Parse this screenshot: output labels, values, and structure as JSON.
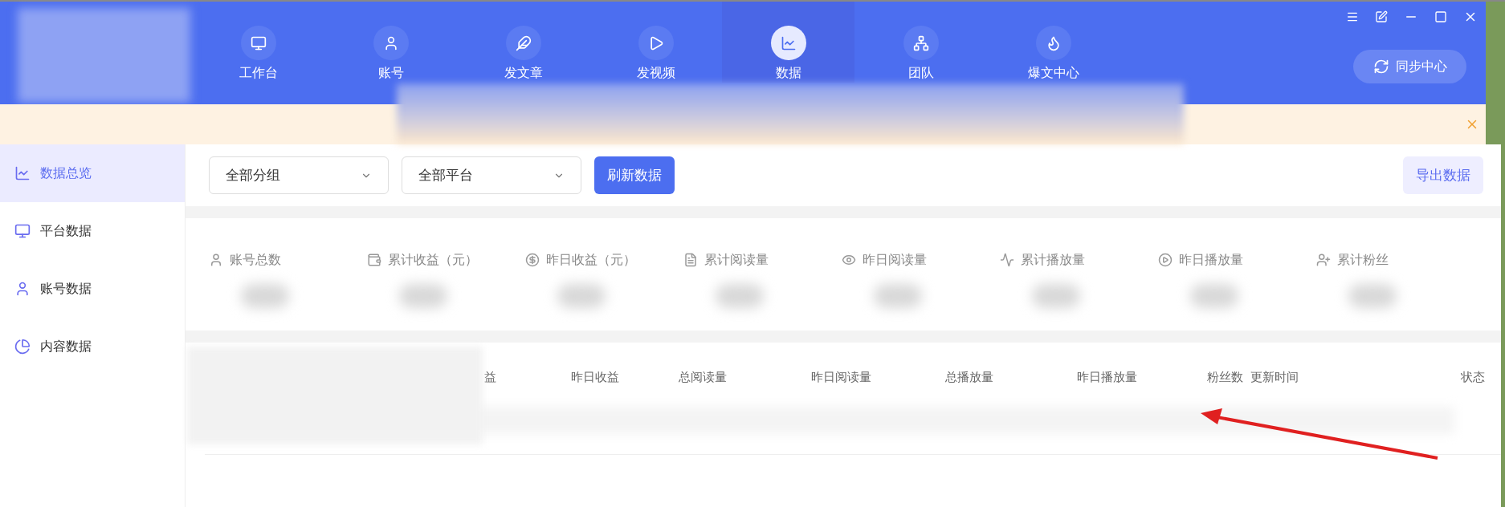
{
  "nav": [
    {
      "label": "工作台",
      "selected": false
    },
    {
      "label": "账号",
      "selected": false
    },
    {
      "label": "发文章",
      "selected": false
    },
    {
      "label": "发视频",
      "selected": false
    },
    {
      "label": "数据",
      "selected": true
    },
    {
      "label": "团队",
      "selected": false
    },
    {
      "label": "爆文中心",
      "selected": false
    }
  ],
  "sync_button": "同步中心",
  "sidebar": [
    {
      "label": "数据总览",
      "selected": true
    },
    {
      "label": "平台数据",
      "selected": false
    },
    {
      "label": "账号数据",
      "selected": false
    },
    {
      "label": "内容数据",
      "selected": false
    }
  ],
  "filters": {
    "group": "全部分组",
    "platform": "全部平台",
    "refresh": "刷新数据",
    "export": "导出数据"
  },
  "stats": [
    "账号总数",
    "累计收益（元）",
    "昨日收益（元）",
    "累计阅读量",
    "昨日阅读量",
    "累计播放量",
    "昨日播放量",
    "累计粉丝"
  ],
  "table": {
    "columns": [
      "益",
      "昨日收益",
      "总阅读量",
      "昨日阅读量",
      "总播放量",
      "昨日播放量",
      "粉丝数",
      "更新时间",
      "状态"
    ]
  }
}
